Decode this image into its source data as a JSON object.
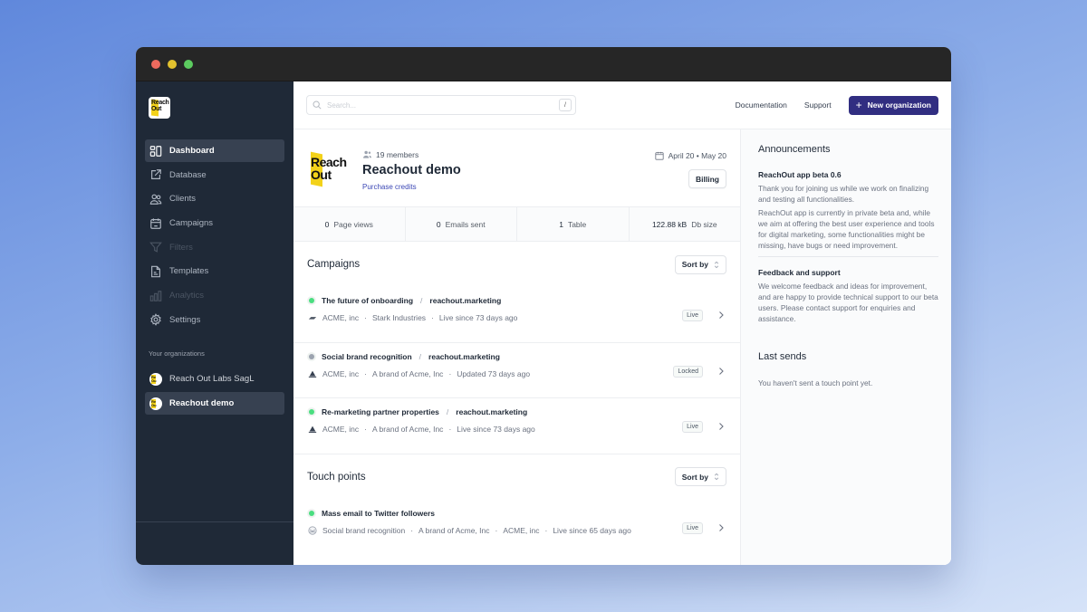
{
  "window": {
    "controls": [
      "close",
      "minimize",
      "maximize"
    ]
  },
  "sidebar": {
    "logo_text_line1": "Reach",
    "logo_text_line2": "Out",
    "items": [
      {
        "label": "Dashboard",
        "icon": "dashboard-icon",
        "state": "active"
      },
      {
        "label": "Database",
        "icon": "external-edit-icon",
        "state": "normal"
      },
      {
        "label": "Clients",
        "icon": "users-icon",
        "state": "normal"
      },
      {
        "label": "Campaigns",
        "icon": "calendar-icon",
        "state": "normal"
      },
      {
        "label": "Filters",
        "icon": "filter-icon",
        "state": "disabled"
      },
      {
        "label": "Templates",
        "icon": "document-icon",
        "state": "normal"
      },
      {
        "label": "Analytics",
        "icon": "bar-chart-icon",
        "state": "disabled"
      },
      {
        "label": "Settings",
        "icon": "gear-icon",
        "state": "normal"
      }
    ],
    "organizations_label": "Your organizations",
    "organizations": [
      {
        "label": "Reach Out Labs SagL",
        "state": "normal"
      },
      {
        "label": "Reachout demo",
        "state": "active"
      }
    ]
  },
  "topbar": {
    "search_placeholder": "Search...",
    "search_shortcut": "/",
    "links": [
      "Documentation",
      "Support"
    ],
    "new_org_button": "New organization",
    "new_org_icon": "+"
  },
  "org": {
    "logo_line1": "Reach",
    "logo_line2": "Out",
    "members": "19 members",
    "name": "Reachout demo",
    "purchase_link": "Purchase credits",
    "date_range": "April 20 • May 20",
    "billing_button": "Billing"
  },
  "stats": [
    {
      "value": "0",
      "label": "Page views"
    },
    {
      "value": "0",
      "label": "Emails sent"
    },
    {
      "value": "1",
      "label": "Table"
    },
    {
      "value": "122.88 kB",
      "label": "Db size"
    }
  ],
  "campaigns": {
    "title": "Campaigns",
    "sort_label": "Sort by",
    "items": [
      {
        "name": "The future of onboarding",
        "domain": "reachout.marketing",
        "status": "live",
        "meta": [
          "ACME, inc",
          "Stark Industries",
          "Live since 73 days ago"
        ],
        "badge": "Live",
        "icon": "brand-logo-icon"
      },
      {
        "name": "Social brand recognition",
        "domain": "reachout.marketing",
        "status": "locked",
        "meta": [
          "ACME, inc",
          "A brand of Acme, Inc",
          "Updated 73 days ago"
        ],
        "badge": "Locked",
        "icon": "triangle-logo-icon"
      },
      {
        "name": "Re-marketing partner properties",
        "domain": "reachout.marketing",
        "status": "live",
        "meta": [
          "ACME, inc",
          "A brand of Acme, Inc",
          "Live since 73 days ago"
        ],
        "badge": "Live",
        "icon": "triangle-logo-icon"
      }
    ]
  },
  "touch_points": {
    "title": "Touch points",
    "sort_label": "Sort by",
    "items": [
      {
        "name": "Mass email to Twitter followers",
        "status": "live",
        "meta": [
          "Social brand recognition",
          "A brand of Acme, Inc",
          "ACME, inc",
          "Live since 65 days ago"
        ],
        "badge": "Live",
        "icon": "mail-icon"
      }
    ]
  },
  "announcements": {
    "title": "Announcements",
    "items": [
      {
        "title": "ReachOut app beta 0.6",
        "paragraphs": [
          "Thank you for joining us while we work on finalizing and testing all functionalities.",
          "ReachOut app is currently in private beta and, while we aim at offering the best user experience and tools for digital marketing, some functionalities might be missing, have bugs or need improvement."
        ]
      },
      {
        "title": "Feedback and support",
        "paragraphs": [
          "We welcome feedback and ideas for improvement, and are happy to provide technical support to our beta users. Please contact support for enquiries and assistance."
        ]
      }
    ]
  },
  "last_sends": {
    "title": "Last sends",
    "empty_text": "You haven't sent a touch point yet."
  },
  "colors": {
    "primary": "#312e81",
    "sidebar_bg": "#1f2937",
    "live": "#4ade80",
    "locked": "#9ca3af",
    "link": "#3b47b5",
    "logo_yellow": "#f3d21a"
  }
}
